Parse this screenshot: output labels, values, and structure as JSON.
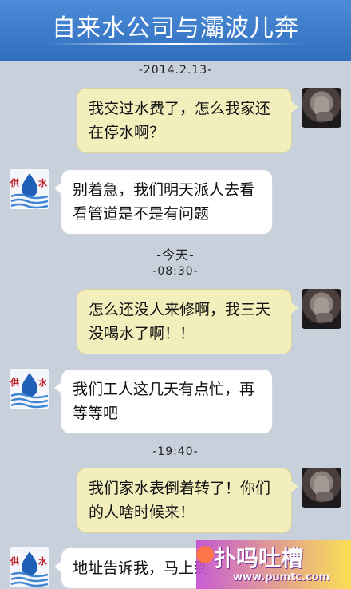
{
  "header": {
    "title": "自来水公司与灞波儿奔"
  },
  "timestamps": [
    "-2014.2.13-",
    "-今天-",
    "-08:30-",
    "-19:40-"
  ],
  "avatars": {
    "water_label_left": "供",
    "water_label_right": "水"
  },
  "messages": [
    {
      "from": "user",
      "text_line1": "我交过水费了，怎么我家还",
      "text_line2": "在停水啊？"
    },
    {
      "from": "company",
      "text_line1": "别着急，我们明天派人去看",
      "text_line2": "看管道是不是有问题"
    },
    {
      "from": "user",
      "text_line1": "怎么还没人来修啊，我三天",
      "text_line2": "没喝水了啊！！"
    },
    {
      "from": "company",
      "text_line1": "我们工人这几天有点忙，再",
      "text_line2": "等等吧"
    },
    {
      "from": "user",
      "text_line1": "我们家水表倒着转了！你们",
      "text_line2": "的人啥时候来！"
    },
    {
      "from": "company",
      "text_line1": "地址告诉我，马上到",
      "text_line2": ""
    }
  ],
  "watermark": {
    "text": "扑吗吐槽",
    "url": "www.pumtc.com"
  },
  "colors": {
    "header": "#3f7fcb",
    "background": "#c8d0dc",
    "bubble_out": "#f3efbd",
    "bubble_in": "#ffffff"
  }
}
